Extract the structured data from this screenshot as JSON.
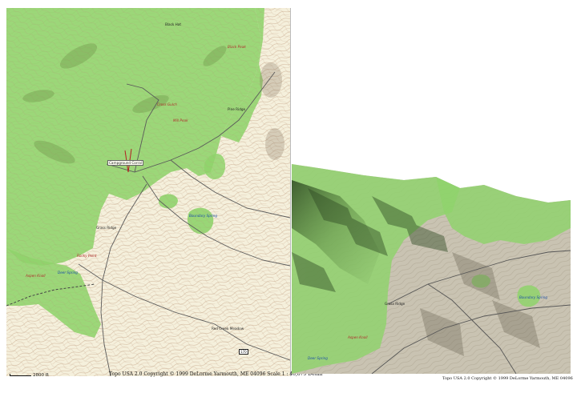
{
  "map2d": {
    "caption": "Topo USA 2.0 Copyright © 1999 DeLorme Yarmouth, ME 04096  Scale 1 : 46,875  Detail",
    "scale_label": "2800 ft",
    "road_label": "170",
    "colors": {
      "paper": "#f5f0dc",
      "forest": "#8fd36b",
      "contour": "#c9a98a",
      "road": "#555555",
      "state_road": "#555555"
    },
    "labels": [
      {
        "id": "black-hat",
        "text": "Black Hat",
        "style": "blk"
      },
      {
        "id": "black-peak",
        "text": "Black Peak",
        "style": "red"
      },
      {
        "id": "cross-gulch",
        "text": "Cross Gulch",
        "style": "red"
      },
      {
        "id": "mill-peak",
        "text": "Mill Peak",
        "style": "red"
      },
      {
        "id": "pine-ridge",
        "text": "Pine Ridge",
        "style": "blk"
      },
      {
        "id": "campground",
        "text": "Campground Corral",
        "style": "box"
      },
      {
        "id": "boundary-spring",
        "text": "Boundary Spring",
        "style": "blue"
      },
      {
        "id": "grass-ridge",
        "text": "Grass Ridge",
        "style": "blk"
      },
      {
        "id": "rocky-point",
        "text": "Rocky Point",
        "style": "red"
      },
      {
        "id": "aspen-knoll",
        "text": "Aspen Knoll",
        "style": "red"
      },
      {
        "id": "deer-spring",
        "text": "Deer Spring",
        "style": "blue"
      },
      {
        "id": "red-creek-meadow",
        "text": "Red Creek Meadow",
        "style": "blk"
      }
    ]
  },
  "map3d": {
    "caption": "Topo USA 2.0 Copyright © 1999 DeLorme Yarmouth, ME 04096",
    "labels": [
      {
        "id": "grass-ridge-3d",
        "text": "Grass Ridge",
        "style": "blk"
      },
      {
        "id": "boundary-spring-3d",
        "text": "Boundary Spring",
        "style": "blue"
      },
      {
        "id": "aspen-knoll-3d",
        "text": "Aspen Knoll",
        "style": "red"
      },
      {
        "id": "deer-spring-3d",
        "text": "Deer Spring",
        "style": "blue"
      }
    ]
  }
}
